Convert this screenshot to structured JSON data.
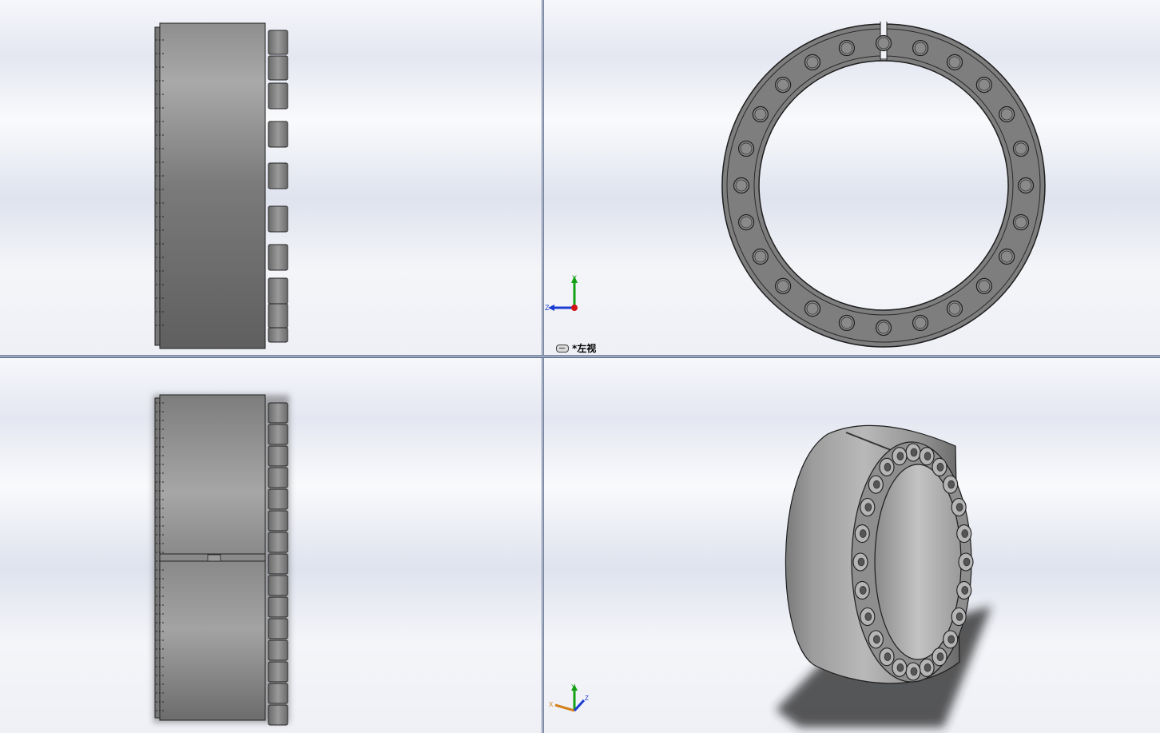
{
  "views": {
    "top_right": {
      "view_name": "*左视"
    }
  },
  "triad": {
    "y_label": "Y",
    "z_label": "Z",
    "x_label": "X"
  },
  "part": {
    "bolt_count_visible": 24
  },
  "colors": {
    "background_light": "#f6f7fb",
    "background_band": "#dfe3ee",
    "divider": "#6f7c98",
    "metal_dark": "#5c5c5c",
    "metal_mid": "#8c8c8c",
    "metal_light": "#b8b8b8",
    "axis_x": "#d21414",
    "axis_y": "#14a014",
    "axis_z": "#1a3cd2"
  }
}
